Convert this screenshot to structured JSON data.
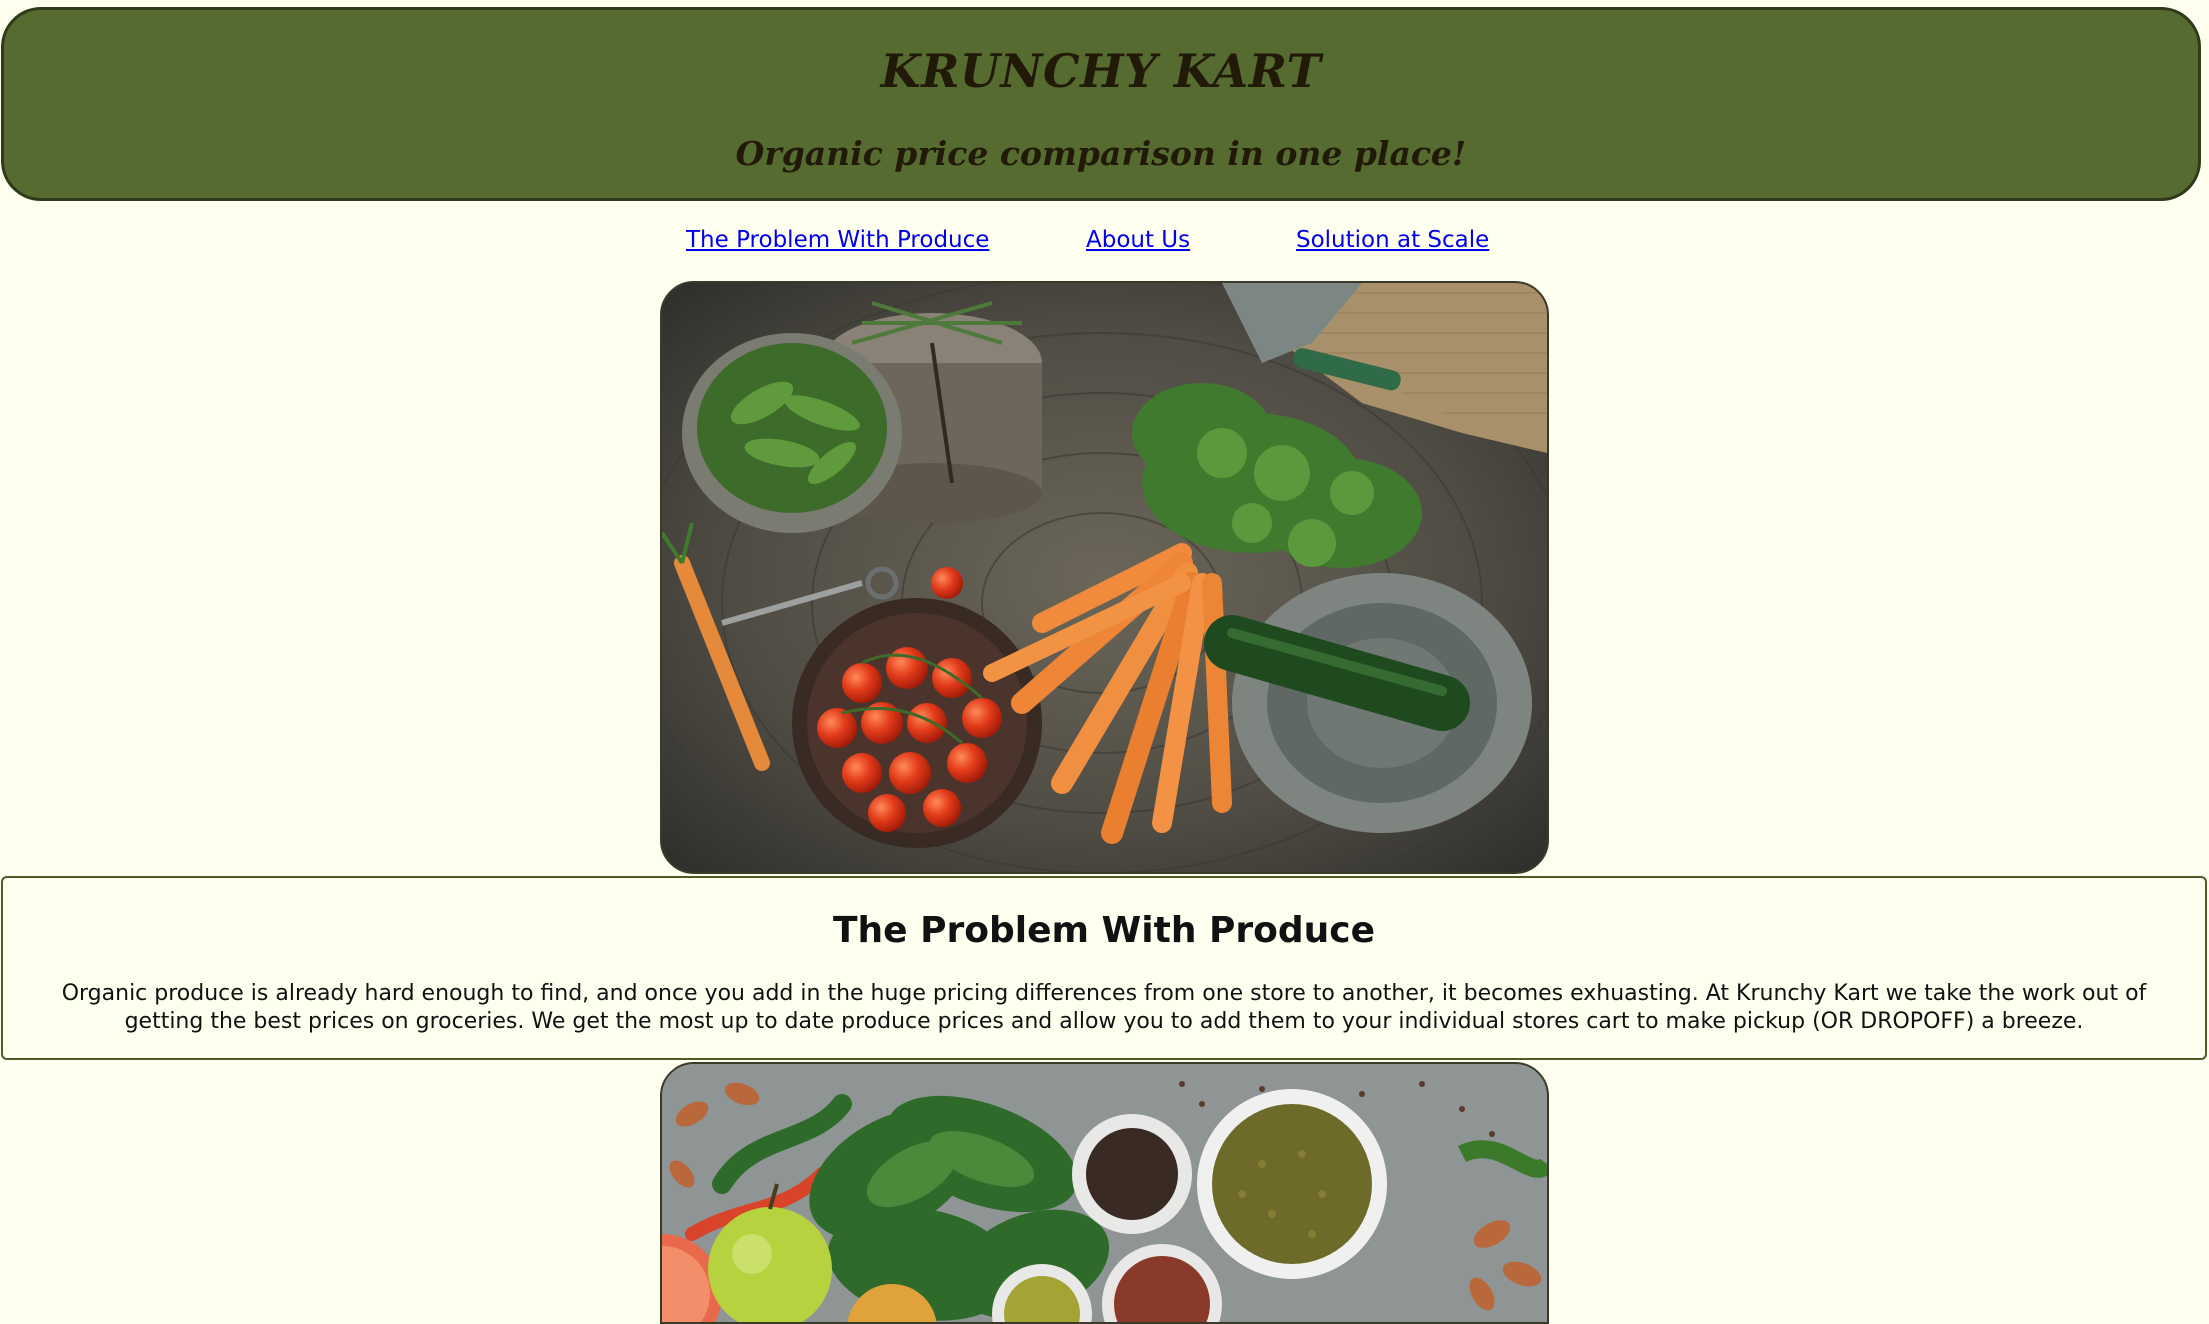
{
  "header": {
    "title": "KRUNCHY KART",
    "subtitle": "Organic price comparison in one place!"
  },
  "nav": {
    "items": [
      {
        "label": "The Problem With Produce"
      },
      {
        "label": "About Us"
      },
      {
        "label": "Solution at Scale"
      }
    ]
  },
  "colors": {
    "page_background": "#fffff0",
    "header_background": "#566b30",
    "header_text": "#221a08",
    "link": "#0000ee",
    "section_border": "#4a5c28"
  },
  "section": {
    "title": "The Problem With Produce",
    "body": "Organic produce is already hard enough to find, and once you add in the huge pricing differences from one store to another, it becomes exhuasting. At Krunchy Kart we take the work out of getting the best prices on groceries. We get the most up to date produce prices and allow you to add them to your individual stores cart to make pickup (OR DROPOFF) a breeze."
  },
  "images": [
    {
      "name": "vegetables-on-stump-photo"
    },
    {
      "name": "greens-and-spices-photo"
    }
  ]
}
